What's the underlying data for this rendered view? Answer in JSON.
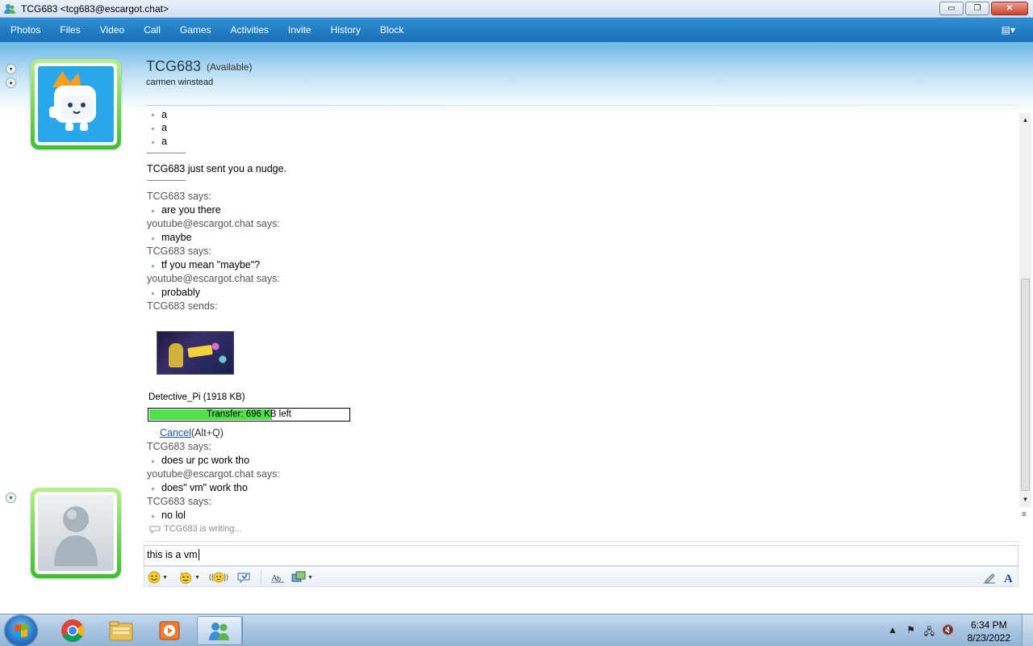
{
  "window": {
    "title": "TCG683 <tcg683@escargot.chat>",
    "buttons": {
      "minimize": "▭",
      "maximize": "❐",
      "close": "✕"
    }
  },
  "menu": {
    "items": [
      "Photos",
      "Files",
      "Video",
      "Call",
      "Games",
      "Activities",
      "Invite",
      "History",
      "Block"
    ],
    "grip": "▤▾"
  },
  "contact": {
    "name": "TCG683",
    "status": "(Available)",
    "personal_message": "carmen winstead"
  },
  "conversation": {
    "early_bullets": [
      "a",
      "a",
      "a"
    ],
    "nudge": "TCG683 just sent you a nudge.",
    "messages": [
      {
        "sender": "TCG683 says:",
        "text": "are you there"
      },
      {
        "sender": "youtube@escargot.chat says:",
        "text": "maybe"
      },
      {
        "sender": "TCG683 says:",
        "text": "tf you mean \"maybe\"?"
      },
      {
        "sender": "youtube@escargot.chat says:",
        "text": "probably"
      }
    ],
    "sends_label": "TCG683 sends:",
    "file": {
      "name": "Detective_Pi (1918 KB)",
      "progress_text": "Transfer: 696 KB left",
      "progress_fraction": 0.62,
      "cancel_label": "Cancel",
      "cancel_hint": "(Alt+Q)",
      "thumb_icon": "pikachu-poster-thumbnail"
    },
    "after_messages": [
      {
        "sender": "TCG683 says:",
        "text": "does ur pc work tho"
      },
      {
        "sender": "youtube@escargot.chat says:",
        "text": "does\" vm\" work tho"
      },
      {
        "sender": "TCG683 says:",
        "text": "no lol"
      }
    ],
    "typing_status": "TCG683 is writing..."
  },
  "input": {
    "value": "this is a vm"
  },
  "toolbar": {
    "emoticon_icon": "smiley-icon",
    "wink_icon": "wink-icon",
    "nudge_icon": "nudge-icon",
    "voice_icon": "voice-clip-icon",
    "font_icon": "font-style-icon",
    "background_icon": "background-icon",
    "handwriting_icon": "pen-icon",
    "text_icon": "text-format-icon"
  },
  "taskbar": {
    "apps": [
      "windows-start",
      "chrome",
      "file-explorer",
      "media-player",
      "messenger"
    ],
    "time": "6:34 PM",
    "date": "8/23/2022"
  },
  "colors": {
    "menu_bar": "#1b6fb7",
    "progress_fill": "#4fe04a",
    "avatar_frame": "#3fbf2f",
    "link": "#1a56a8"
  }
}
